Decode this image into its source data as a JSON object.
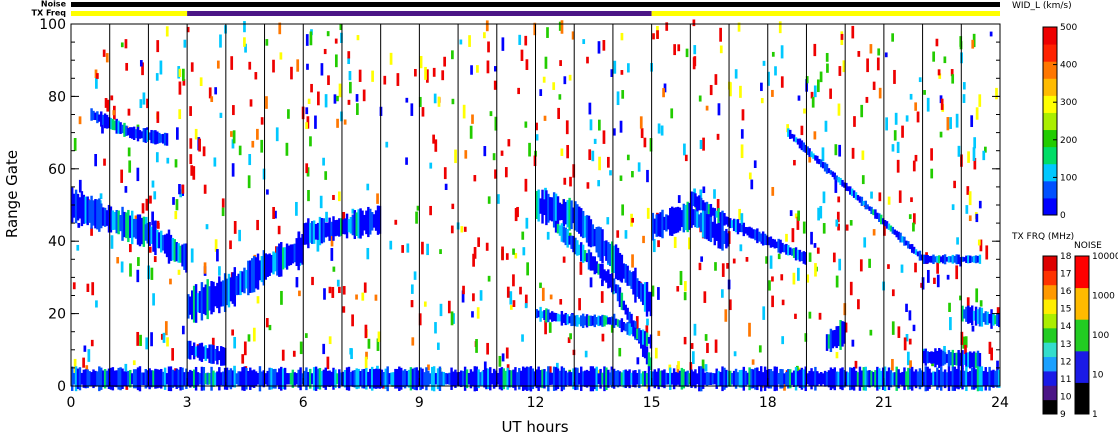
{
  "header": {
    "noise_label": "Noise",
    "txfreq_label": "TX Freq",
    "noise_bar_color": "#000000",
    "txfreq_segments": [
      {
        "from": 0,
        "to": 3,
        "color": "#ffff00"
      },
      {
        "from": 3,
        "to": 15,
        "color": "#4b1586"
      },
      {
        "from": 15,
        "to": 24,
        "color": "#ffff00"
      }
    ]
  },
  "chart_data": {
    "type": "heatmap",
    "xlabel": "UT hours",
    "ylabel": "Range Gate",
    "xlim": [
      0,
      24
    ],
    "ylim": [
      0,
      100
    ],
    "x_ticks": [
      0,
      3,
      6,
      9,
      12,
      15,
      18,
      21,
      24
    ],
    "y_ticks": [
      0,
      20,
      40,
      60,
      80,
      100
    ],
    "vertical_lines_hours": [
      1,
      2,
      3,
      4,
      5,
      6,
      7,
      8,
      9,
      10,
      11,
      12,
      13,
      14,
      15,
      16,
      17,
      18,
      19,
      20,
      21,
      22,
      23
    ],
    "colorbar_velocity": {
      "title": "WID_L (km/s)",
      "ticks": [
        0,
        100,
        200,
        300,
        400,
        500
      ],
      "colors": [
        "#0000ff",
        "#0050ff",
        "#00c8ff",
        "#00dd66",
        "#22cc00",
        "#aaee00",
        "#ffff00",
        "#ffbb00",
        "#ff7700",
        "#ff2200",
        "#ee0000"
      ]
    },
    "colorbar_txfreq": {
      "title": "TX FRQ (MHz)",
      "labels": [
        "9",
        "10",
        "11",
        "12",
        "13",
        "14",
        "15",
        "16",
        "17",
        "18"
      ],
      "colors": [
        "#000000",
        "#4b1586",
        "#1a1ae6",
        "#1aa0ff",
        "#33ddcc",
        "#22cc22",
        "#aaee00",
        "#ffee00",
        "#ff9900",
        "#ff3300",
        "#dd0000"
      ]
    },
    "colorbar_noise": {
      "title": "NOISE",
      "labels": [
        "1",
        "10",
        "100",
        "1000",
        "10000"
      ],
      "colors": [
        "#000000",
        "#1a1ae6",
        "#22cc22",
        "#ffbb00",
        "#ff0000"
      ]
    },
    "echo_bands": [
      {
        "points": [
          [
            0,
            50
          ],
          [
            1,
            46
          ],
          [
            2,
            42
          ],
          [
            3,
            35
          ]
        ],
        "width": 7
      },
      {
        "points": [
          [
            3,
            22
          ],
          [
            4,
            26
          ],
          [
            5,
            33
          ],
          [
            6,
            38
          ]
        ],
        "width": 8
      },
      {
        "points": [
          [
            6,
            42
          ],
          [
            7,
            44
          ],
          [
            8,
            46
          ]
        ],
        "width": 6
      },
      {
        "points": [
          [
            12,
            50
          ],
          [
            13,
            47
          ],
          [
            14,
            35
          ],
          [
            15,
            22
          ]
        ],
        "width": 7
      },
      {
        "points": [
          [
            12.5,
            44
          ],
          [
            14,
            28
          ],
          [
            15,
            5
          ]
        ],
        "width": 4
      },
      {
        "points": [
          [
            15,
            44
          ],
          [
            16,
            47
          ],
          [
            17,
            40
          ]
        ],
        "width": 6
      },
      {
        "points": [
          [
            16,
            52
          ],
          [
            17,
            45
          ],
          [
            18,
            40
          ],
          [
            19,
            35
          ]
        ],
        "width": 3
      },
      {
        "points": [
          [
            18.5,
            70
          ],
          [
            20,
            55
          ],
          [
            21,
            45
          ],
          [
            22,
            35
          ],
          [
            23.5,
            35
          ]
        ],
        "width": 2
      },
      {
        "points": [
          [
            0.5,
            75
          ],
          [
            1.5,
            70
          ],
          [
            2.5,
            68
          ]
        ],
        "width": 3
      },
      {
        "points": [
          [
            3,
            10
          ],
          [
            4,
            8
          ]
        ],
        "width": 4
      },
      {
        "points": [
          [
            12,
            20
          ],
          [
            13,
            18
          ],
          [
            14,
            18
          ],
          [
            15,
            12
          ]
        ],
        "width": 3
      },
      {
        "points": [
          [
            19.5,
            12
          ],
          [
            20,
            15
          ]
        ],
        "width": 6
      },
      {
        "points": [
          [
            22,
            8
          ],
          [
            23.5,
            7
          ]
        ],
        "width": 4
      },
      {
        "points": [
          [
            23,
            20
          ],
          [
            24,
            18
          ]
        ],
        "width": 4
      },
      {
        "points": [
          [
            0,
            2
          ],
          [
            24,
            2
          ]
        ],
        "width": 5
      }
    ]
  }
}
